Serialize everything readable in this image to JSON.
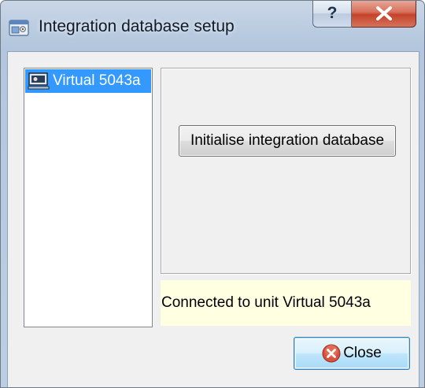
{
  "window": {
    "title": "Integration database setup",
    "help_glyph": "?",
    "icons": {
      "title_icon": "database-setup-icon",
      "help": "help-icon",
      "close": "close-icon"
    }
  },
  "units": {
    "items": [
      {
        "label": "Virtual 5043a",
        "icon": "device-unit-icon",
        "selected": true
      }
    ]
  },
  "actions": {
    "initialise_label": "Initialise integration database",
    "close_label": "Close",
    "close_icon": "close-circle-icon"
  },
  "status": {
    "message": "Connected to unit Virtual 5043a",
    "background": "#ffffe1"
  },
  "colors": {
    "selection": "#3399ff",
    "caption_close": "#c5432a",
    "panel_background": "#f0f0f0"
  }
}
